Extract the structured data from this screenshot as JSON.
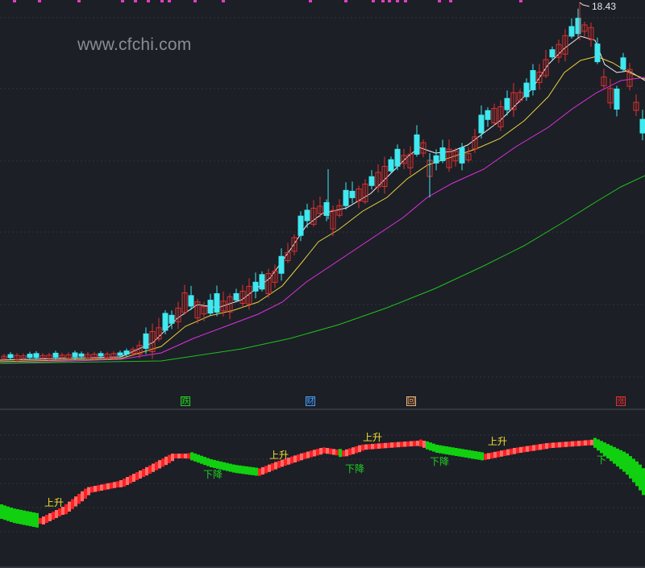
{
  "watermark": "www.cfchi.com",
  "high_price_label": "18.43",
  "colors": {
    "background": "#1c1f26",
    "grid": "#30333a",
    "up_candle": "#e03030",
    "down_candle": "#40e8f0",
    "ma_white": "#f0f0f0",
    "ma_yellow": "#e8d040",
    "ma_magenta": "#e030e0",
    "ma_green": "#20c020",
    "top_markers": "#e040c0",
    "trend_up": "#ff2020",
    "trend_down": "#10d010",
    "signal_up_text": "#f0e030",
    "signal_down_text": "#20d020"
  },
  "badges": [
    {
      "label": "跌",
      "color": "#20d020"
    },
    {
      "label": "财",
      "color": "#40a0ff"
    },
    {
      "label": "回",
      "color": "#f0b070"
    },
    {
      "label": "涨",
      "color": "#e03030"
    }
  ],
  "signals": [
    {
      "label": "上升",
      "type": "up"
    },
    {
      "label": "下降",
      "type": "down"
    },
    {
      "label": "上升",
      "type": "up"
    },
    {
      "label": "下降",
      "type": "down"
    },
    {
      "label": "上升",
      "type": "up"
    },
    {
      "label": "下降",
      "type": "down"
    },
    {
      "label": "上升",
      "type": "up"
    },
    {
      "label": "下",
      "type": "down"
    }
  ]
}
